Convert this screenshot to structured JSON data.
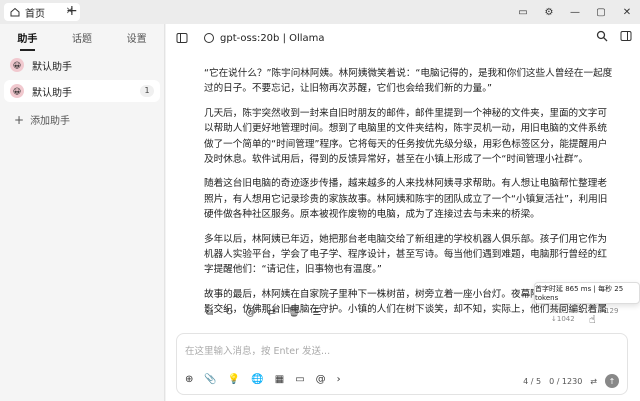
{
  "titlebar": {
    "tab_label": "首页",
    "close_tab": "✕",
    "new_tab": "+",
    "window_buttons": [
      "▭",
      "⚙",
      "—",
      "▢",
      "✕"
    ]
  },
  "sidebar": {
    "tabs": [
      {
        "label": "助手",
        "active": true
      },
      {
        "label": "话题",
        "active": false
      },
      {
        "label": "设置",
        "active": false
      }
    ],
    "assistants": [
      {
        "label": "默认助手",
        "selected": false
      },
      {
        "label": "默认助手",
        "selected": true,
        "count": "1"
      }
    ],
    "add_label": "添加助手"
  },
  "header": {
    "model": "gpt-oss:20b | Ollama",
    "icons": [
      "panel-icon",
      "search-icon",
      "layout-icon"
    ]
  },
  "message": {
    "paragraphs": [
      "“它在说什么？”陈宇问林阿姨。林阿姨微笑着说：“电脑记得的，是我和你们这些人曾经在一起度过的日子。不要忘记，让旧物再次苏醒，它们也会给我们新的力量。”",
      "几天后，陈宇突然收到一封来自旧时朋友的邮件，邮件里提到一个神秘的文件夹，里面的文字可以帮助人们更好地管理时间。想到了电脑里的文件夹结构，陈宇灵机一动，用旧电脑的文件系统做了一个简单的“时间管理”程序。它将每天的任务按优先级分级，用彩色标签区分，能提醒用户及时休息。软件试用后，得到的反馈异常好，甚至在小镇上形成了一个“时间管理小社群”。",
      "随着这台旧电脑的奇迹逐步传播，越来越多的人来找林阿姨寻求帮助。有人想让电脑帮忙整理老照片，有人想用它记录珍贵的家族故事。林阿姨和陈宇的团队成立了一个“小镇复活社”，利用旧硬件做各种社区服务。原本被视作废物的电脑，成为了连接过去与未来的桥梁。",
      "多年以后，林阿姨已年迈，她把那台老电脑交给了新组建的学校机器人俱乐部。孩子们用它作为机器人实验平台，学会了电子学、程序设计，甚至写诗。每当他们遇到难题，电脑那行曾经的红字提醒他们：“请记住，旧事物也有温度。”",
      "故事的最后，林阿姨在自家院子里种下一株树苗，树旁立着一座小台灯。夜幕降临时，灯光与树影交织，仿佛那台旧电脑在守护。小镇的人们在树下谈笑，却不知，实际上，他们共同编织着属于自己的“旧物复活史”——一点一滴，慢慢将这座小镇演绎成了时代的交汇点。"
    ],
    "tokens": "Tokens: 1171 ↑129 ↓1042",
    "tooltip": "首字时延 865 ms | 每秒 25 tokens"
  },
  "composer": {
    "placeholder": "在这里输入消息，按 Enter 发送...",
    "page": "4 / 5",
    "count": "0 / 1230"
  }
}
